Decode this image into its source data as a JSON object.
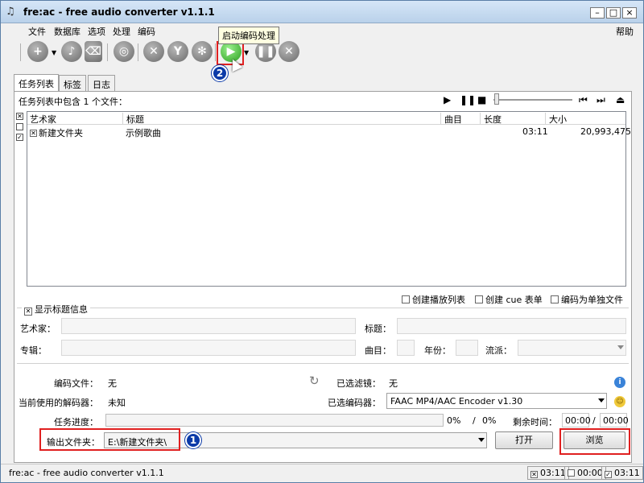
{
  "window": {
    "title": "fre:ac - free audio converter v1.1.1"
  },
  "menu": {
    "items": [
      "文件",
      "数据库",
      "选项",
      "处理",
      "编码"
    ],
    "help": "帮助"
  },
  "tooltip": "启动编码处理",
  "callouts": {
    "one": "1",
    "two": "2"
  },
  "tabs": [
    "任务列表",
    "标签",
    "日志"
  ],
  "joblist": {
    "count_label": "任务列表中包含 1 个文件：",
    "columns": [
      "艺术家",
      "标题",
      "曲目",
      "长度",
      "大小"
    ],
    "rows": [
      {
        "artist": "新建文件夹",
        "title": "示例歌曲",
        "track": "",
        "length": "03:11",
        "size": "20,993,475"
      }
    ]
  },
  "list_options": {
    "create_playlist": "创建播放列表",
    "create_cue": "创建 cue 表单",
    "encode_separate": "编码为单独文件"
  },
  "title_info": {
    "legend": "显示标题信息",
    "artist": "艺术家：",
    "title": "标题：",
    "album": "专辑：",
    "track": "曲目：",
    "year": "年份：",
    "genre": "流派："
  },
  "encoding": {
    "file_label": "编码文件：",
    "file_value": "无",
    "filter_label": "已选滤镜：",
    "filter_value": "无",
    "decoder_label": "当前使用的解码器：",
    "decoder_value": "未知",
    "encoder_label": "已选编码器：",
    "encoder_value": "FAAC MP4/AAC Encoder v1.30",
    "progress_label": "任务进度：",
    "progress_pct_a": "0%",
    "progress_sep": "/",
    "progress_pct_b": "0%",
    "progress_value": 0,
    "remaining_label": "剩余时间：",
    "time_a": "00:00",
    "time_sep": "/",
    "time_b": "00:00",
    "output_label": "输出文件夹：",
    "output_value": "E:\\新建文件夹\\",
    "open_button": "打开",
    "browse_button": "浏览"
  },
  "status": {
    "text": "fre:ac - free audio converter v1.1.1",
    "selected_time": "03:11",
    "unselected_time": "00:00",
    "total_time": "03:11"
  }
}
